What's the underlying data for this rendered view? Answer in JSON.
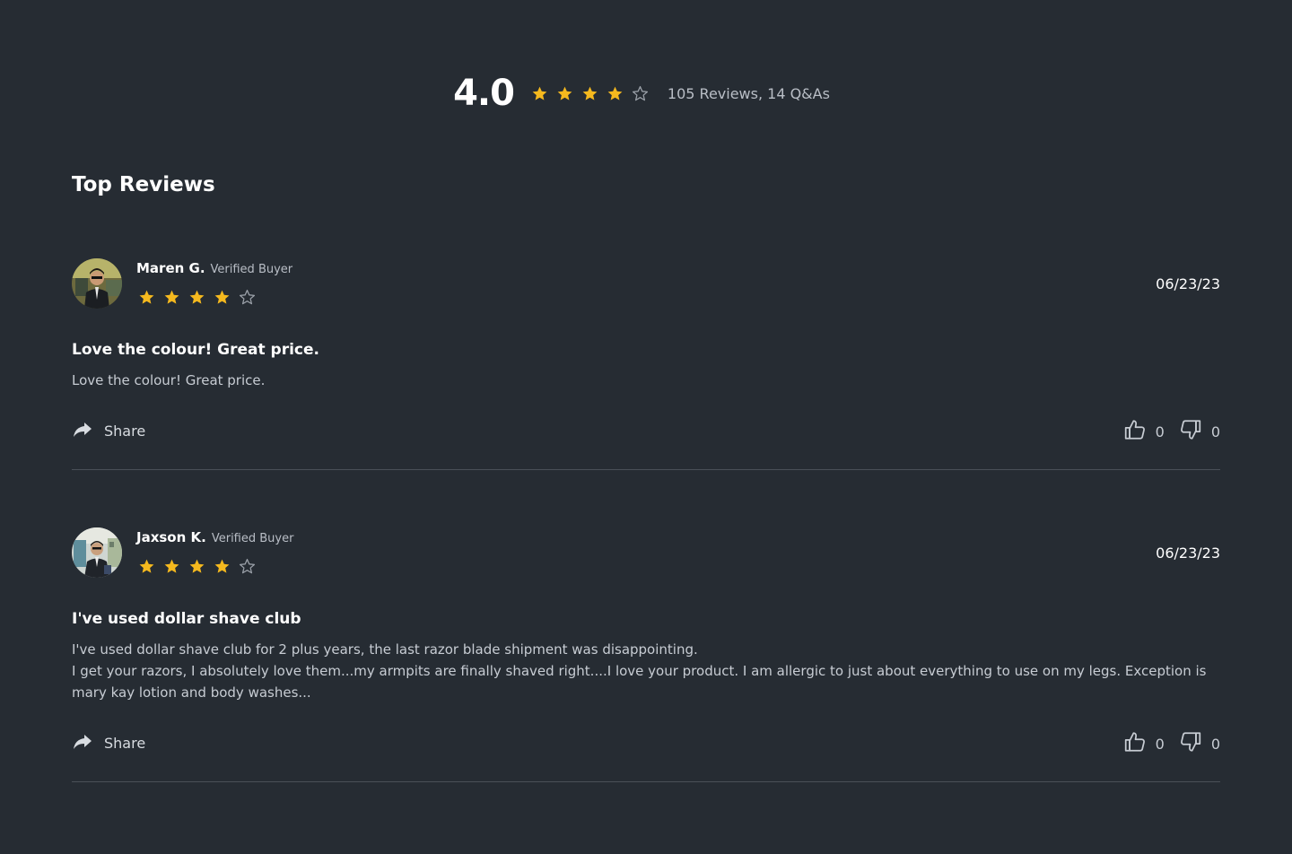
{
  "summary": {
    "score": "4.0",
    "rating": 4,
    "max_rating": 5,
    "counts": "105 Reviews, 14 Q&As"
  },
  "section_title": "Top Reviews",
  "reviews": [
    {
      "name": "Maren G.",
      "badge": "Verified Buyer",
      "rating": 4,
      "date": "06/23/23",
      "title": "Love the colour! Great price.",
      "body": [
        "Love the colour! Great price."
      ],
      "share_label": "Share",
      "likes": "0",
      "dislikes": "0"
    },
    {
      "name": "Jaxson K.",
      "badge": "Verified Buyer",
      "rating": 4,
      "date": "06/23/23",
      "title": "I've used dollar shave club",
      "body": [
        "I've used dollar shave club for 2 plus years, the last razor blade shipment was disappointing.",
        "I get your razors, I absolutely love them...my armpits are finally shaved right....I love your product. I am allergic to just about everything to use on my legs. Exception is mary kay lotion and body washes..."
      ],
      "share_label": "Share",
      "likes": "0",
      "dislikes": "0"
    }
  ],
  "colors": {
    "background": "#262c33",
    "star_filled": "#f5b91e",
    "star_empty": "#9aa0a8",
    "divider": "#4a5058"
  },
  "icons": {
    "star": "star-icon",
    "share": "share-arrow-icon",
    "like": "thumbs-up-icon",
    "dislike": "thumbs-down-icon"
  }
}
